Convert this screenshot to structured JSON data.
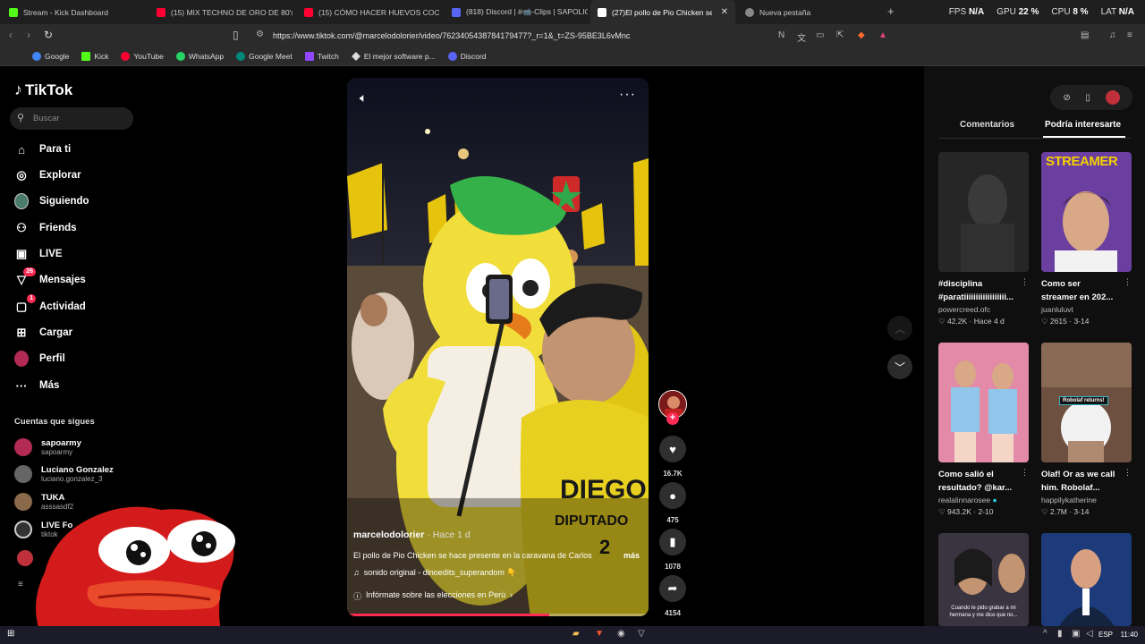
{
  "browser": {
    "tabs": [
      {
        "title": "Stream - Kick Dashboard",
        "color": "#53fc18"
      },
      {
        "title": "(15) MIX TECHNO DE ORO DE 80's &",
        "color": "#ff0033"
      },
      {
        "title": "(15) CÓMO HACER HUEVOS COCIDO",
        "color": "#ff0033"
      },
      {
        "title": "(818) Discord | #📹-Clips | SAPOLIOS",
        "color": "#5865f2"
      },
      {
        "title": "(27)El pollo de Pio Chicken se",
        "color": "#ffffff"
      },
      {
        "title": "Nueva pestaña",
        "color": "#888888"
      }
    ],
    "new_tab": "+",
    "stats": {
      "fps_label": "FPS",
      "fps_value": "N/A",
      "gpu_label": "GPU",
      "gpu_value": "22 %",
      "cpu_label": "CPU",
      "cpu_value": "8 %",
      "lat_label": "LAT",
      "lat_value": "N/A"
    },
    "url": "https://www.tiktok.com/@marcelodolorier/video/7623405438784179477?_r=1&_t=ZS-95BE3L6vMnc",
    "bookmarks": [
      {
        "label": "Google",
        "color": "#4285f4"
      },
      {
        "label": "Kick",
        "color": "#53fc18"
      },
      {
        "label": "YouTube",
        "color": "#ff0033"
      },
      {
        "label": "WhatsApp",
        "color": "#25d366"
      },
      {
        "label": "Google Meet",
        "color": "#00897b"
      },
      {
        "label": "Twitch",
        "color": "#9146ff"
      },
      {
        "label": "El mejor software p...",
        "color": "#dddddd"
      },
      {
        "label": "Discord",
        "color": "#5865f2"
      }
    ]
  },
  "tiktok": {
    "logo": "TikTok",
    "search_placeholder": "Buscar",
    "nav": [
      {
        "label": "Para ti",
        "icon": "home-icon",
        "glyph": "⌂"
      },
      {
        "label": "Explorar",
        "icon": "compass-icon",
        "glyph": "◎"
      },
      {
        "label": "Siguiendo",
        "icon": "following-avatar-icon",
        "glyph": "●"
      },
      {
        "label": "Friends",
        "icon": "friends-icon",
        "glyph": "⚇"
      },
      {
        "label": "LIVE",
        "icon": "live-icon",
        "glyph": "▣"
      },
      {
        "label": "Mensajes",
        "icon": "messages-icon",
        "glyph": "▽",
        "badge": "26"
      },
      {
        "label": "Actividad",
        "icon": "activity-icon",
        "glyph": "▢",
        "badge": "1"
      },
      {
        "label": "Cargar",
        "icon": "upload-icon",
        "glyph": "⊞"
      },
      {
        "label": "Perfil",
        "icon": "profile-avatar-icon",
        "glyph": "●"
      },
      {
        "label": "Más",
        "icon": "more-icon",
        "glyph": "···"
      }
    ],
    "following_heading": "Cuentas que sigues",
    "following": [
      {
        "name": "sapoarmy",
        "user": "sapoarmy",
        "color": "#b22a55"
      },
      {
        "name": "Luciano Gonzalez",
        "user": "luciano.gonzalez_3",
        "color": "#666666"
      },
      {
        "name": "TUKA",
        "user": "asssasdf2",
        "color": "#8a6a4a"
      },
      {
        "name": "LIVE Fo",
        "user": "tiktok",
        "color": "#333333"
      }
    ],
    "video": {
      "author": "marcelodolorier",
      "time": " · Hace 1 d",
      "description": "El pollo de Pio Chicken se hace presente en la caravana de Carlos",
      "more": "más",
      "music": "sonido original - dinoedits_superandom 👇",
      "info": "Infórmate sobre las elecciones en Perú",
      "progress": 0.67
    },
    "actions": {
      "likes": "16.7K",
      "comments": "475",
      "saves": "1078",
      "shares": "4154"
    },
    "right": {
      "tab_comments": "Comentarios",
      "tab_interest": "Podría interesarte",
      "cards": [
        {
          "title1": "#disciplina",
          "title2": "#paratiiiiiiiiiiiiiiiiii...",
          "user": "powercreed.ofc",
          "stats": "♡ 42.2K · Hace 4 d",
          "bg": "#2b2b2b",
          "accent": "#555555",
          "label": ""
        },
        {
          "title1": "Como ser",
          "title2": "streamer en 202...",
          "user": "juanluluvt",
          "stats": "♡ 2615 · 3-14",
          "bg": "#6a3fa0",
          "accent": "#f5d000",
          "label": "STREAMER"
        },
        {
          "title1": "Como salió el",
          "title2": "resultado? @kar...",
          "user": "realalinnarosee",
          "stats": "♡ 943.2K · 2-10",
          "bg": "#e28aa8",
          "accent": "#8fc6ea",
          "label": ""
        },
        {
          "title1": "Olaf! Or as we call",
          "title2": "him. Robolaf...",
          "user": "happilykatherine",
          "stats": "♡ 2.7M · 3-14",
          "bg": "#6d5040",
          "accent": "#36b8c8",
          "label": "Robolaf returns!"
        },
        {
          "title1": "",
          "title2": "",
          "user": "",
          "stats": "",
          "bg": "#3a3340",
          "accent": "#5a4a40",
          "label": "Cuando le pido grabar a mi hermana y me dice que no..."
        },
        {
          "title1": "",
          "title2": "",
          "user": "",
          "stats": "",
          "bg": "#1d3b7a",
          "accent": "#d8a080",
          "label": ""
        }
      ]
    }
  },
  "taskbar": {
    "lang": "ESP",
    "time": "11:40"
  }
}
